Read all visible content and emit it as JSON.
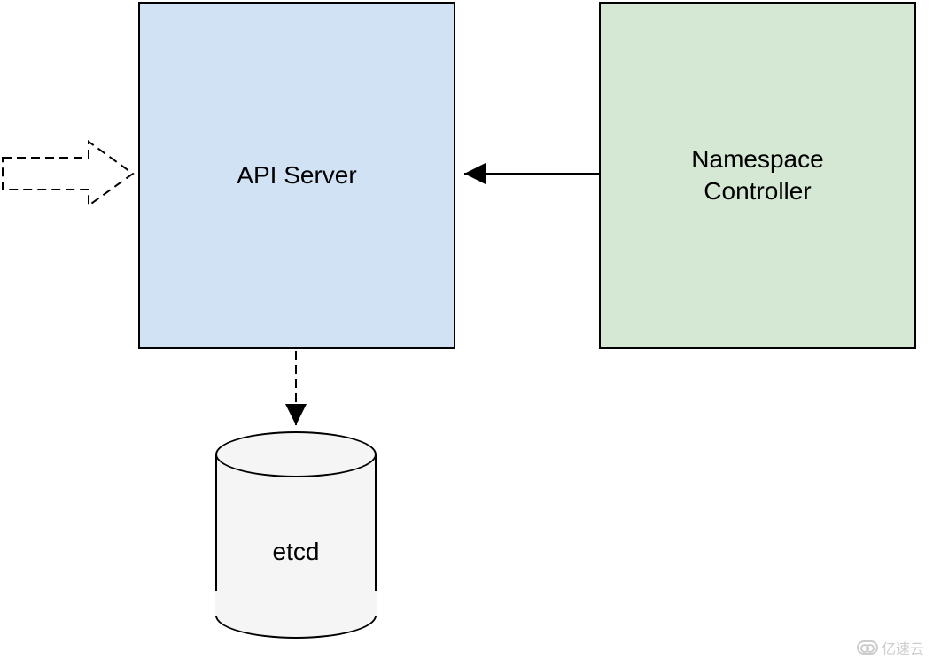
{
  "diagram": {
    "nodes": {
      "api_server": {
        "label": "API Server",
        "type": "process",
        "fill": "#d1e2f4"
      },
      "namespace_controller": {
        "label": "Namespace\nController",
        "type": "process",
        "fill": "#d5e8d4"
      },
      "etcd": {
        "label": "etcd",
        "type": "datastore",
        "fill": "#f5f5f5"
      }
    },
    "edges": [
      {
        "from": "external",
        "to": "api_server",
        "style": "dashed",
        "arrow": "block"
      },
      {
        "from": "namespace_controller",
        "to": "api_server",
        "style": "solid",
        "arrow": "filled"
      },
      {
        "from": "api_server",
        "to": "etcd",
        "style": "dashed",
        "arrow": "filled"
      }
    ]
  },
  "watermark": {
    "text": "亿速云"
  }
}
